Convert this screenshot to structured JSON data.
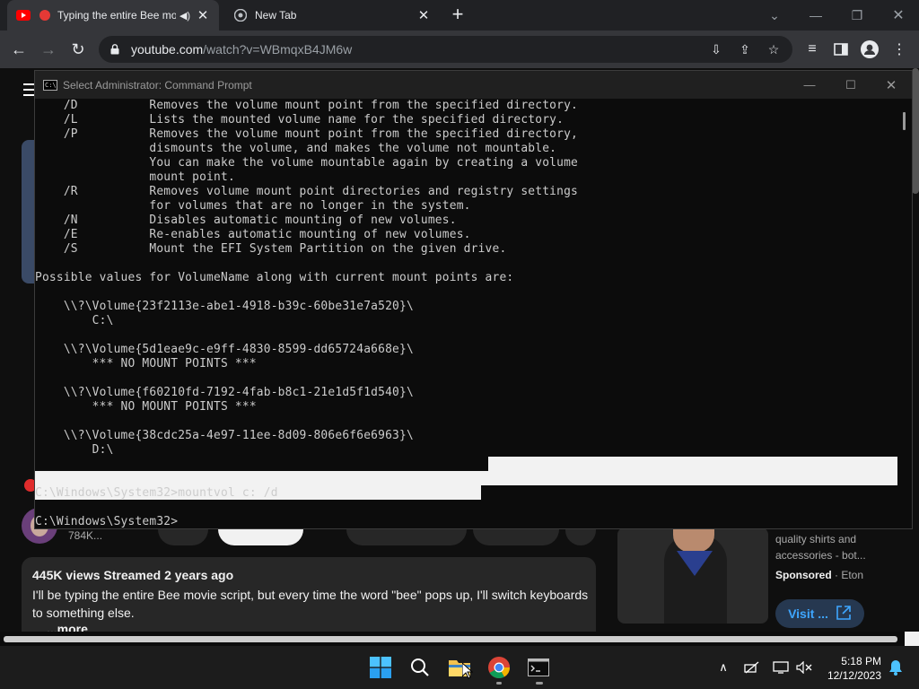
{
  "browser": {
    "tabs": [
      {
        "title": "Typing the entire Bee mo",
        "active": true
      },
      {
        "title": "New Tab",
        "active": false
      }
    ],
    "url_host": "youtube.com",
    "url_path": "/watch?v=WBmqxB4JM6w"
  },
  "youtube": {
    "channel_subs": "784K...",
    "views_line": "445K views  Streamed 2 years ago",
    "description": "I'll be typing the entire Bee movie script, but every time the word \"bee\" pops up, I'll switch keyboards to something else.",
    "more": "...more",
    "ad": {
      "text": "quality shirts and accessories - bot...",
      "sponsored": "Sponsored",
      "advertiser": "Eton",
      "visit_label": "Visit ..."
    }
  },
  "cmd": {
    "title": "Select Administrator: Command Prompt",
    "lines": [
      "    /D          Removes the volume mount point from the specified directory.",
      "    /L          Lists the mounted volume name for the specified directory.",
      "    /P          Removes the volume mount point from the specified directory,",
      "                dismounts the volume, and makes the volume not mountable.",
      "                You can make the volume mountable again by creating a volume",
      "                mount point.",
      "    /R          Removes volume mount point directories and registry settings",
      "                for volumes that are no longer in the system.",
      "    /N          Disables automatic mounting of new volumes.",
      "    /E          Re-enables automatic mounting of new volumes.",
      "    /S          Mount the EFI System Partition on the given drive.",
      "",
      "Possible values for VolumeName along with current mount points are:",
      "",
      "    \\\\?\\Volume{23f2113e-abe1-4918-b39c-60be31e7a520}\\",
      "        C:\\",
      "",
      "    \\\\?\\Volume{5d1eae9c-e9ff-4830-8599-dd65724a668e}\\",
      "        *** NO MOUNT POINTS ***",
      "",
      "    \\\\?\\Volume{f60210fd-7192-4fab-b8c1-21e1d5f1d540}\\",
      "        *** NO MOUNT POINTS ***",
      "",
      "    \\\\?\\Volume{38cdc25a-4e97-11ee-8d09-806e6f6e6963}\\",
      "        D:\\",
      "",
      "",
      "C:\\Windows\\System32>mountvol c: /d",
      "",
      "C:\\Windows\\System32>"
    ]
  },
  "taskbar": {
    "time": "5:18 PM",
    "date": "12/12/2023"
  },
  "colors": {
    "chrome_tabstrip": "#202124",
    "chrome_toolbar": "#35363a",
    "cmd_bg": "#0c0c0c",
    "cmd_text": "#cccccc",
    "selection": "#f2f2f2",
    "youtube_red": "#ff0000",
    "taskbar": "#1c1c1c"
  }
}
